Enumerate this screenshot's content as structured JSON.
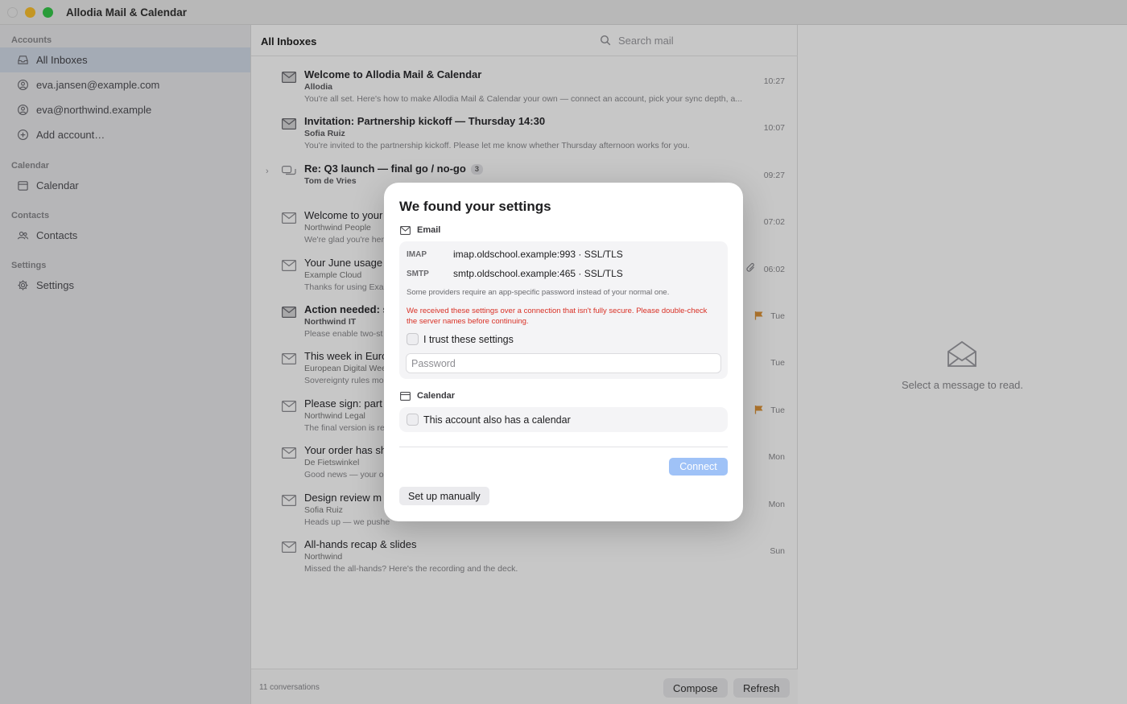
{
  "app": {
    "title": "Allodia Mail & Calendar"
  },
  "sidebar": {
    "sections": {
      "accounts": "Accounts",
      "calendar": "Calendar",
      "contacts": "Contacts",
      "settings": "Settings"
    },
    "items": [
      {
        "label": "All Inboxes",
        "icon": "inbox-icon",
        "active": true
      },
      {
        "label": "eva.jansen@example.com",
        "icon": "account-icon"
      },
      {
        "label": "eva@northwind.example",
        "icon": "account-icon"
      },
      {
        "label": "Add account…",
        "icon": "plus-circle-icon"
      },
      {
        "label": "Calendar",
        "icon": "calendar-icon"
      },
      {
        "label": "Contacts",
        "icon": "contacts-icon"
      },
      {
        "label": "Settings",
        "icon": "gear-icon"
      }
    ]
  },
  "list": {
    "title": "All Inboxes",
    "search_placeholder": "Search mail",
    "messages": [
      {
        "subject": "Welcome to Allodia Mail & Calendar",
        "sender": "Allodia",
        "preview": "You're all set. Here's how to make Allodia Mail & Calendar your own — connect an account, pick your sync depth, a...",
        "time": "10:27",
        "unread": true
      },
      {
        "subject": "Invitation: Partnership kickoff — Thursday 14:30",
        "sender": "Sofia Ruiz",
        "preview": "You're invited to the partnership kickoff. Please let me know whether Thursday afternoon works for you.",
        "time": "10:07",
        "unread": true
      },
      {
        "subject": "Re: Q3 launch — final go / no-go",
        "count": "3",
        "sender": "Tom de Vries",
        "preview": "",
        "time": "09:27",
        "unread": true
      },
      {
        "subject": "Welcome to your",
        "sender": "Northwind People",
        "preview": "We're glad you're her",
        "time": "07:02",
        "unread": false
      },
      {
        "subject": "Your June usage",
        "sender": "Example Cloud",
        "preview": "Thanks for using Exa",
        "time": "06:02",
        "unread": false,
        "attachment": true
      },
      {
        "subject": "Action needed: s",
        "sender": "Northwind IT",
        "preview": "Please enable two-st",
        "time": "Tue",
        "unread": true,
        "flagged": true
      },
      {
        "subject": "This week in Euro",
        "sender": "European Digital Wee",
        "preview": "Sovereignty rules mo",
        "time": "Tue",
        "unread": false
      },
      {
        "subject": "Please sign: part",
        "sender": "Northwind Legal",
        "preview": "The final version is re",
        "time": "Tue",
        "unread": false,
        "flagged": true
      },
      {
        "subject": "Your order has sh",
        "sender": "De Fietswinkel",
        "preview": "Good news — your or",
        "time": "Mon",
        "unread": false
      },
      {
        "subject": "Design review m",
        "sender": "Sofia Ruiz",
        "preview": "Heads up — we pushe",
        "time": "Mon",
        "unread": false
      },
      {
        "subject": "All-hands recap & slides",
        "sender": "Northwind",
        "preview": "Missed the all-hands? Here's the recording and the deck.",
        "time": "Sun",
        "unread": false
      }
    ],
    "footer": {
      "count_text": "11 conversations",
      "compose_label": "Compose",
      "refresh_label": "Refresh"
    }
  },
  "reading": {
    "empty_text": "Select a message to read."
  },
  "dialog": {
    "title": "We found your settings",
    "email_section": "Email",
    "imap_kind": "IMAP",
    "imap_value": "imap.oldschool.example:993 · SSL/TLS",
    "smtp_kind": "SMTP",
    "smtp_value": "smtp.oldschool.example:465 · SSL/TLS",
    "hint": "Some providers require an app-specific password instead of your normal one.",
    "warning": "We received these settings over a connection that isn't fully secure. Please double-check the server names before continuing.",
    "trust_label": "I trust these settings",
    "password_placeholder": "Password",
    "calendar_section": "Calendar",
    "calendar_label": "This account also has a calendar",
    "connect_label": "Connect",
    "manual_label": "Set up manually",
    "warning_color": "#d93025",
    "connect_color": "#9fc2f7"
  }
}
